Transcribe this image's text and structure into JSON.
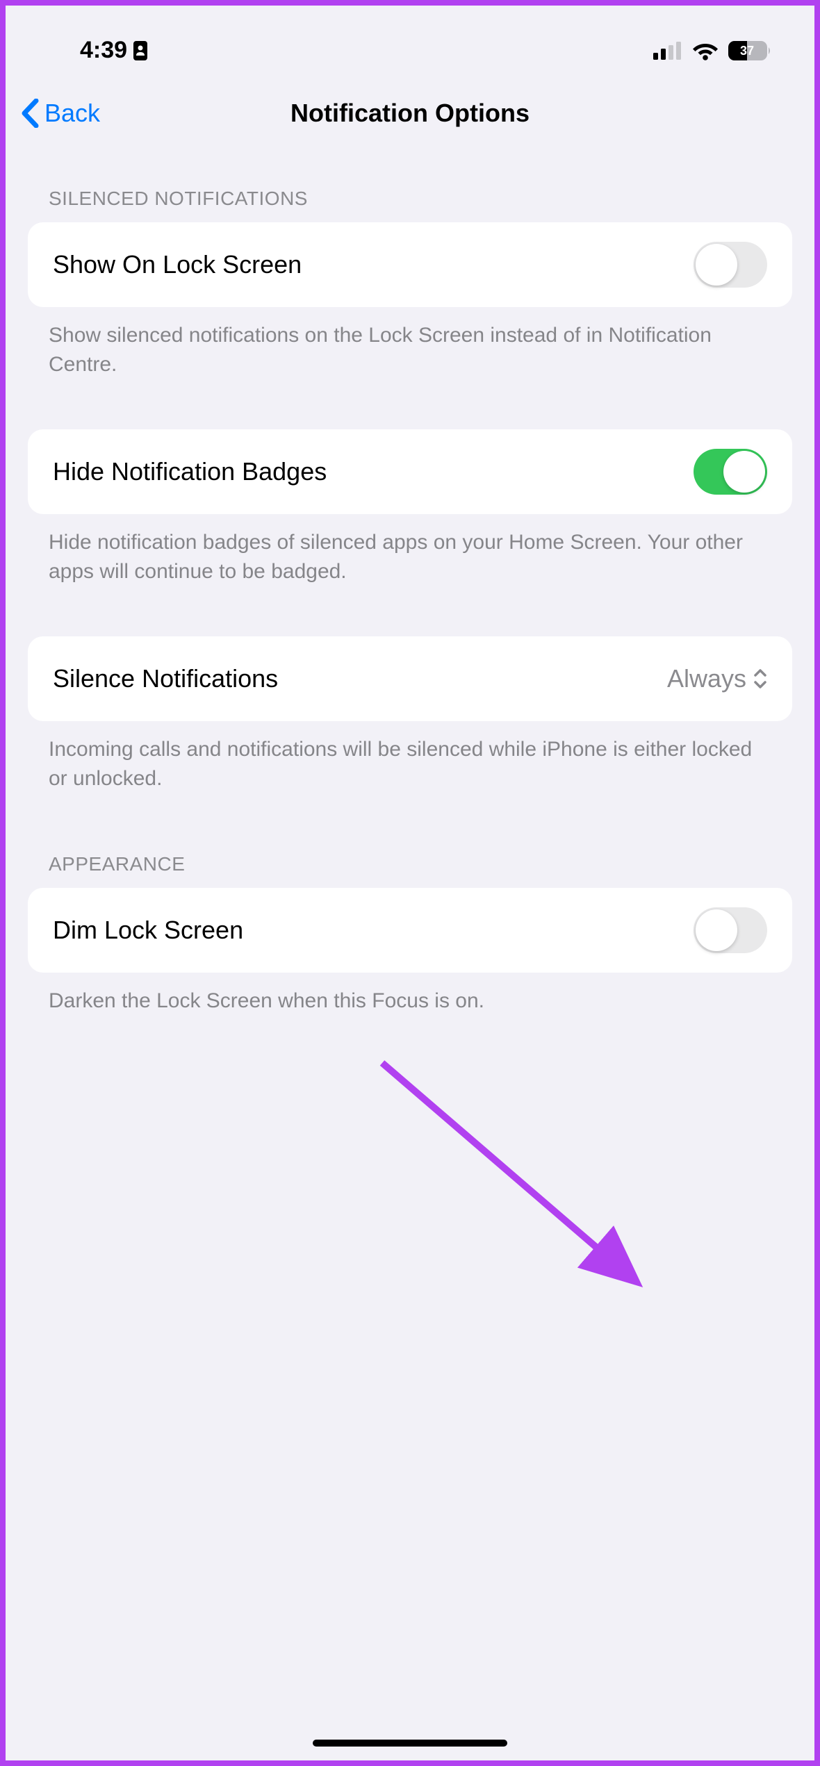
{
  "status": {
    "time": "4:39",
    "battery": "37"
  },
  "nav": {
    "back": "Back",
    "title": "Notification Options"
  },
  "sections": {
    "silenced": {
      "header": "SILENCED NOTIFICATIONS",
      "show_lock": {
        "label": "Show On Lock Screen",
        "footer": "Show silenced notifications on the Lock Screen instead of in Notification Centre."
      },
      "hide_badges": {
        "label": "Hide Notification Badges",
        "footer": "Hide notification badges of silenced apps on your Home Screen. Your other apps will continue to be badged."
      },
      "silence": {
        "label": "Silence Notifications",
        "value": "Always",
        "footer": "Incoming calls and notifications will be silenced while iPhone is either locked or unlocked."
      }
    },
    "appearance": {
      "header": "APPEARANCE",
      "dim": {
        "label": "Dim Lock Screen",
        "footer": "Darken the Lock Screen when this Focus is on."
      }
    }
  }
}
